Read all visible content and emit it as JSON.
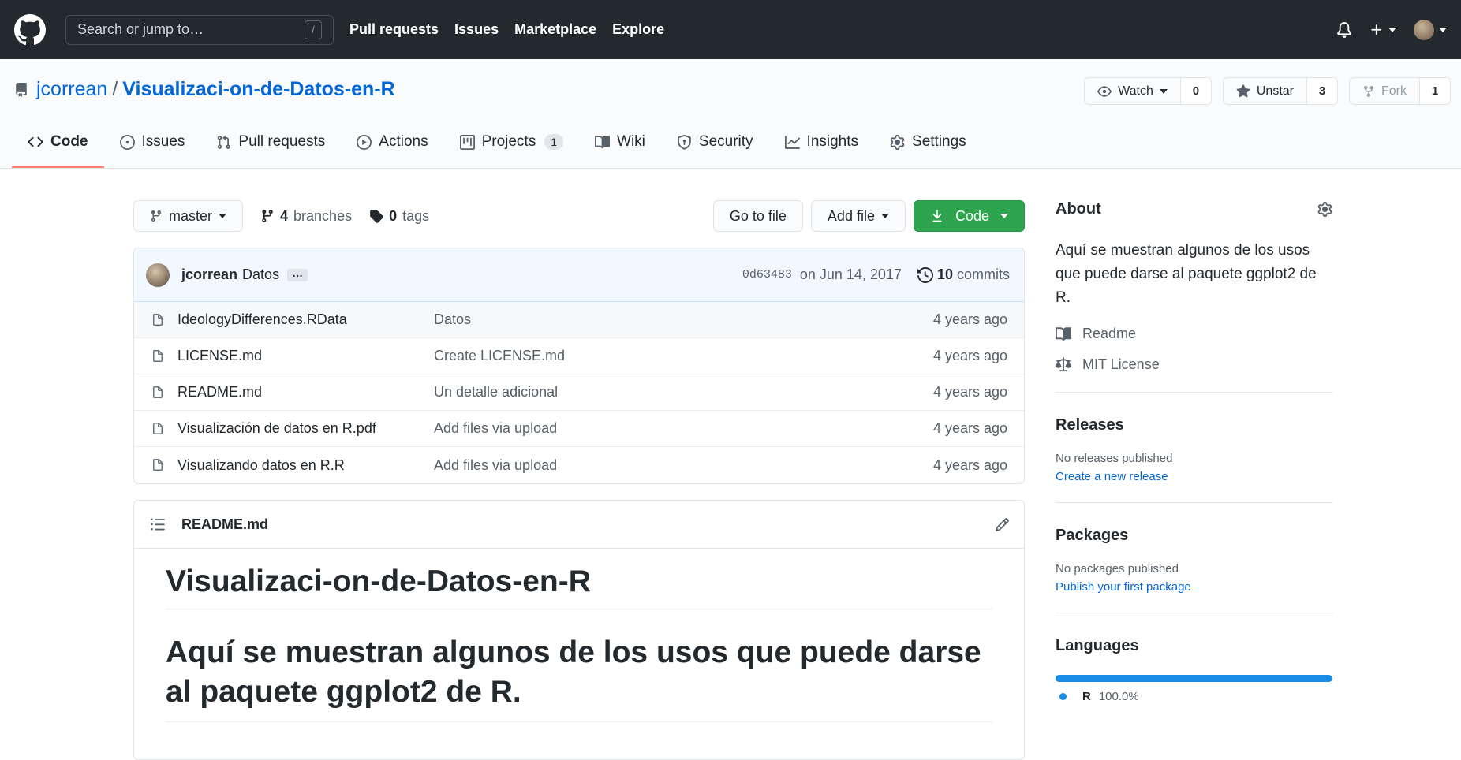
{
  "header": {
    "search_placeholder": "Search or jump to…",
    "search_shortcut": "/",
    "nav": [
      "Pull requests",
      "Issues",
      "Marketplace",
      "Explore"
    ]
  },
  "repo": {
    "owner": "jcorrean",
    "separator": "/",
    "name": "Visualizaci-on-de-Datos-en-R",
    "watch_label": "Watch",
    "watch_count": "0",
    "star_label": "Unstar",
    "star_count": "3",
    "fork_label": "Fork",
    "fork_count": "1"
  },
  "tabs": [
    {
      "label": "Code"
    },
    {
      "label": "Issues"
    },
    {
      "label": "Pull requests"
    },
    {
      "label": "Actions"
    },
    {
      "label": "Projects",
      "counter": "1"
    },
    {
      "label": "Wiki"
    },
    {
      "label": "Security"
    },
    {
      "label": "Insights"
    },
    {
      "label": "Settings"
    }
  ],
  "filebar": {
    "branch": "master",
    "branches_count": "4",
    "branches_label": "branches",
    "tags_count": "0",
    "tags_label": "tags",
    "go_to_file": "Go to file",
    "add_file": "Add file",
    "code": "Code"
  },
  "commit": {
    "author": "jcorrean",
    "message": "Datos",
    "ellipsis": "…",
    "sha": "0d63483",
    "date": "on Jun 14, 2017",
    "commits_count": "10",
    "commits_label": "commits"
  },
  "files": [
    {
      "name": "IdeologyDifferences.RData",
      "message": "Datos",
      "age": "4 years ago"
    },
    {
      "name": "LICENSE.md",
      "message": "Create LICENSE.md",
      "age": "4 years ago"
    },
    {
      "name": "README.md",
      "message": "Un detalle adicional",
      "age": "4 years ago"
    },
    {
      "name": "Visualización de datos en R.pdf",
      "message": "Add files via upload",
      "age": "4 years ago"
    },
    {
      "name": "Visualizando datos en R.R",
      "message": "Add files via upload",
      "age": "4 years ago"
    }
  ],
  "readme": {
    "filename": "README.md",
    "h1": "Visualizaci-on-de-Datos-en-R",
    "h2": "Aquí se muestran algunos de los usos que puede darse al paquete ggplot2 de R."
  },
  "sidebar": {
    "about_title": "About",
    "about_text": "Aquí se muestran algunos de los usos que puede darse al paquete ggplot2 de R.",
    "readme_link": "Readme",
    "license_link": "MIT License",
    "releases_title": "Releases",
    "releases_none": "No releases published",
    "releases_link": "Create a new release",
    "packages_title": "Packages",
    "packages_none": "No packages published",
    "packages_link": "Publish your first package",
    "languages_title": "Languages",
    "language_name": "R",
    "language_percent": "100.0%"
  },
  "colors": {
    "header_bg": "#24292e",
    "link": "#0366d6",
    "green_button": "#2ea44f",
    "tab_underline": "#f9826c",
    "lang_r": "#198ce7"
  }
}
